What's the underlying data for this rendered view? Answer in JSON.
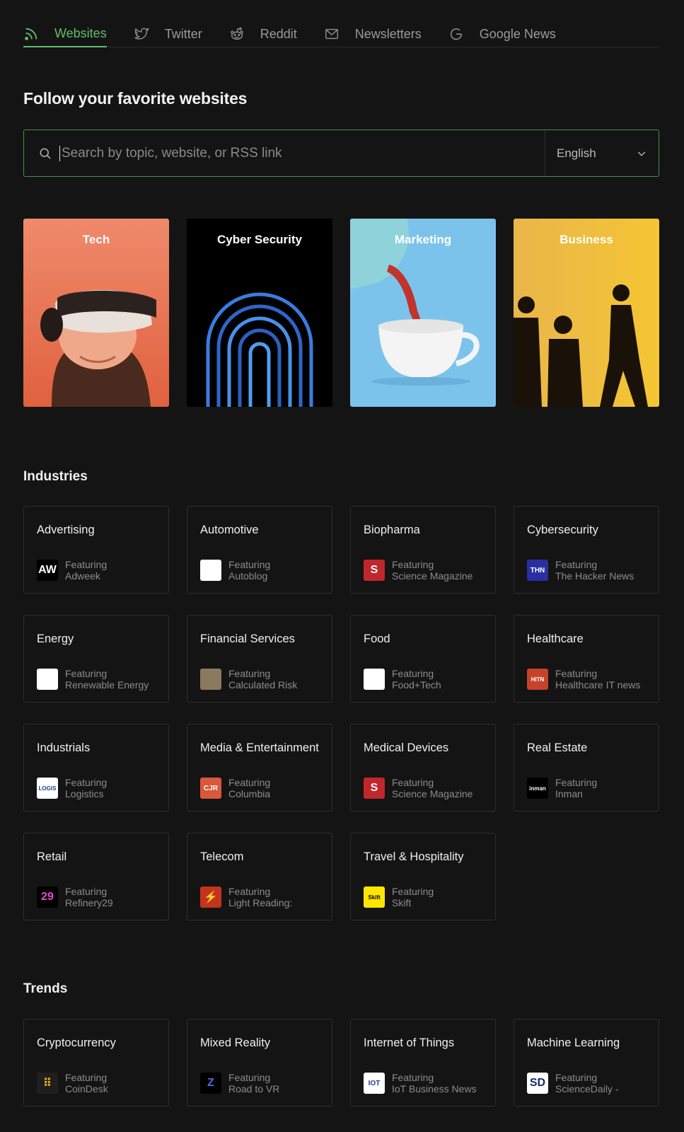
{
  "tabs": [
    {
      "label": "Websites",
      "icon": "rss-icon",
      "active": true
    },
    {
      "label": "Twitter",
      "icon": "twitter-icon",
      "active": false
    },
    {
      "label": "Reddit",
      "icon": "reddit-icon",
      "active": false
    },
    {
      "label": "Newsletters",
      "icon": "mail-icon",
      "active": false
    },
    {
      "label": "Google News",
      "icon": "google-icon",
      "active": false
    }
  ],
  "page_title": "Follow your favorite websites",
  "search": {
    "placeholder": "Search by topic, website, or RSS link",
    "value": "",
    "language": "English"
  },
  "categories": [
    {
      "label": "Tech"
    },
    {
      "label": "Cyber Security"
    },
    {
      "label": "Marketing"
    },
    {
      "label": "Business"
    }
  ],
  "industries": {
    "title": "Industries",
    "featuring_label": "Featuring",
    "items": [
      {
        "name": "Advertising",
        "source": "Adweek",
        "logo_text": "AW",
        "logo_bg": "#000000",
        "logo_fg": "#ffffff"
      },
      {
        "name": "Automotive",
        "source": "Autoblog",
        "logo_text": "",
        "logo_bg": "#ffffff",
        "logo_fg": "#e03a2b"
      },
      {
        "name": "Biopharma",
        "source": "Science Magazine",
        "logo_text": "S",
        "logo_bg": "#c0272d",
        "logo_fg": "#ffffff"
      },
      {
        "name": "Cybersecurity",
        "source": "The Hacker News",
        "logo_text": "THN",
        "logo_bg": "#2a2fa0",
        "logo_fg": "#ffffff"
      },
      {
        "name": "Energy",
        "source": "Renewable Energy",
        "logo_text": "",
        "logo_bg": "#ffffff",
        "logo_fg": "#3a7a2a"
      },
      {
        "name": "Financial Services",
        "source": "Calculated Risk",
        "logo_text": "",
        "logo_bg": "#8a7a60",
        "logo_fg": "#ffffff"
      },
      {
        "name": "Food",
        "source": "Food+Tech",
        "logo_text": "",
        "logo_bg": "#ffffff",
        "logo_fg": "#6aa84f"
      },
      {
        "name": "Healthcare",
        "source": "Healthcare IT news",
        "logo_text": "HITN",
        "logo_bg": "#c5432a",
        "logo_fg": "#ffffff"
      },
      {
        "name": "Industrials",
        "source": "Logistics",
        "logo_text": "LOGIS",
        "logo_bg": "#ffffff",
        "logo_fg": "#1d3f8a"
      },
      {
        "name": "Media & Entertainment",
        "source": "Columbia",
        "logo_text": "CJR",
        "logo_bg": "#d9573a",
        "logo_fg": "#ffffff"
      },
      {
        "name": "Medical Devices",
        "source": "Science Magazine",
        "logo_text": "S",
        "logo_bg": "#c0272d",
        "logo_fg": "#ffffff"
      },
      {
        "name": "Real Estate",
        "source": "Inman",
        "logo_text": "inman",
        "logo_bg": "#000000",
        "logo_fg": "#ffffff"
      },
      {
        "name": "Retail",
        "source": "Refinery29",
        "logo_text": "29",
        "logo_bg": "#000000",
        "logo_fg": "#e54bd1"
      },
      {
        "name": "Telecom",
        "source": "Light Reading:",
        "logo_text": "⚡",
        "logo_bg": "#c3341f",
        "logo_fg": "#ffffff"
      },
      {
        "name": "Travel & Hospitality",
        "source": "Skift",
        "logo_text": "Skift",
        "logo_bg": "#ffe600",
        "logo_fg": "#000000"
      }
    ]
  },
  "trends": {
    "title": "Trends",
    "featuring_label": "Featuring",
    "items": [
      {
        "name": "Cryptocurrency",
        "source": "CoinDesk",
        "logo_text": "⠿",
        "logo_bg": "#1f1f1f",
        "logo_fg": "#f5b800"
      },
      {
        "name": "Mixed Reality",
        "source": "Road to VR",
        "logo_text": "Z",
        "logo_bg": "#000000",
        "logo_fg": "#4a6fd6"
      },
      {
        "name": "Internet of Things",
        "source": "IoT Business News",
        "logo_text": "IOT",
        "logo_bg": "#ffffff",
        "logo_fg": "#1b3b8a"
      },
      {
        "name": "Machine Learning",
        "source": "ScienceDaily -",
        "logo_text": "SD",
        "logo_bg": "#ffffff",
        "logo_fg": "#1a2a6a"
      }
    ]
  },
  "colors": {
    "accent": "#5fbf6a",
    "background": "#141414",
    "card_border": "#2e2e2e"
  }
}
